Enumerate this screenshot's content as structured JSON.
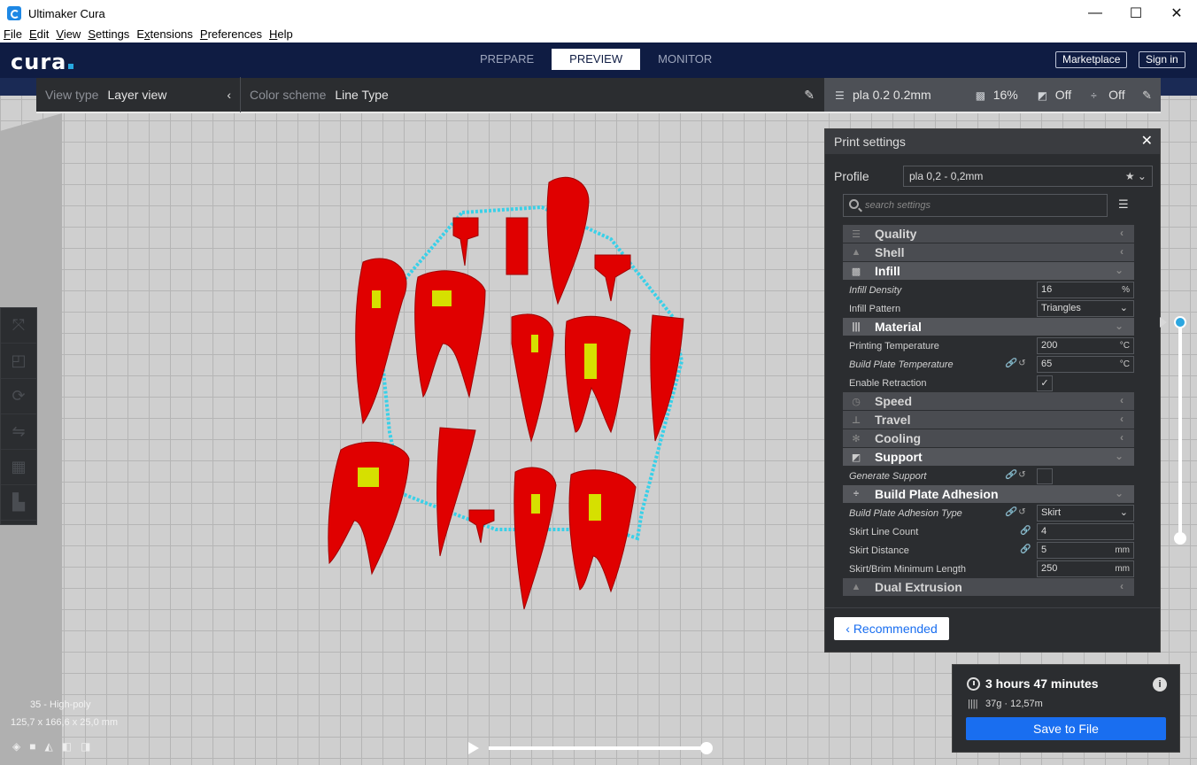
{
  "window": {
    "title": "Ultimaker Cura",
    "minimize": "—",
    "maximize": "☐",
    "close": "✕"
  },
  "menu": [
    {
      "label": "File",
      "key": "F"
    },
    {
      "label": "Edit",
      "key": "E"
    },
    {
      "label": "View",
      "key": "V"
    },
    {
      "label": "Settings",
      "key": "S"
    },
    {
      "label": "Extensions",
      "key": "x"
    },
    {
      "label": "Preferences",
      "key": "P"
    },
    {
      "label": "Help",
      "key": "H"
    }
  ],
  "header": {
    "logo": "cura",
    "tabs": [
      "PREPARE",
      "PREVIEW",
      "MONITOR"
    ],
    "active_tab": "PREVIEW",
    "marketplace": "Marketplace",
    "sign_in": "Sign in"
  },
  "viewbar": {
    "view_type_label": "View type",
    "view_type_value": "Layer view",
    "color_scheme_label": "Color scheme",
    "color_scheme_value": "Line Type"
  },
  "printbar": {
    "profile": "pla 0.2 0.2mm",
    "infill": "16%",
    "support": "Off",
    "adhesion": "Off"
  },
  "panel": {
    "title": "Print settings",
    "profile_label": "Profile",
    "profile_value": "pla 0,2 - 0,2mm",
    "search_placeholder": "search settings",
    "recommended": "Recommended",
    "categories": {
      "quality": "Quality",
      "shell": "Shell",
      "infill": "Infill",
      "material": "Material",
      "speed": "Speed",
      "travel": "Travel",
      "cooling": "Cooling",
      "support": "Support",
      "adhesion": "Build Plate Adhesion",
      "dual": "Dual Extrusion"
    },
    "settings": {
      "infill_density": {
        "label": "Infill Density",
        "value": "16",
        "unit": "%"
      },
      "infill_pattern": {
        "label": "Infill Pattern",
        "value": "Triangles"
      },
      "print_temp": {
        "label": "Printing Temperature",
        "value": "200",
        "unit": "°C"
      },
      "plate_temp": {
        "label": "Build Plate Temperature",
        "value": "65",
        "unit": "°C"
      },
      "retraction": {
        "label": "Enable Retraction",
        "checked": "✓"
      },
      "gen_support": {
        "label": "Generate Support"
      },
      "adhesion_type": {
        "label": "Build Plate Adhesion Type",
        "value": "Skirt"
      },
      "skirt_lines": {
        "label": "Skirt Line Count",
        "value": "4"
      },
      "skirt_distance": {
        "label": "Skirt Distance",
        "value": "5",
        "unit": "mm"
      },
      "skirt_min_len": {
        "label": "Skirt/Brim Minimum Length",
        "value": "250",
        "unit": "mm"
      }
    }
  },
  "object": {
    "name": "35 - High-poly",
    "dims": "125,7 x 166,6 x 25,0 mm"
  },
  "output": {
    "time": "3 hours 47 minutes",
    "material": "37g · 12,57m",
    "save": "Save to File"
  },
  "colors": {
    "header_bg": "#0f1c43",
    "accent_blue": "#196ef0",
    "model_red": "#e00000",
    "infill_yellow": "#d6e000",
    "skirt_cyan": "#39d0e8"
  }
}
